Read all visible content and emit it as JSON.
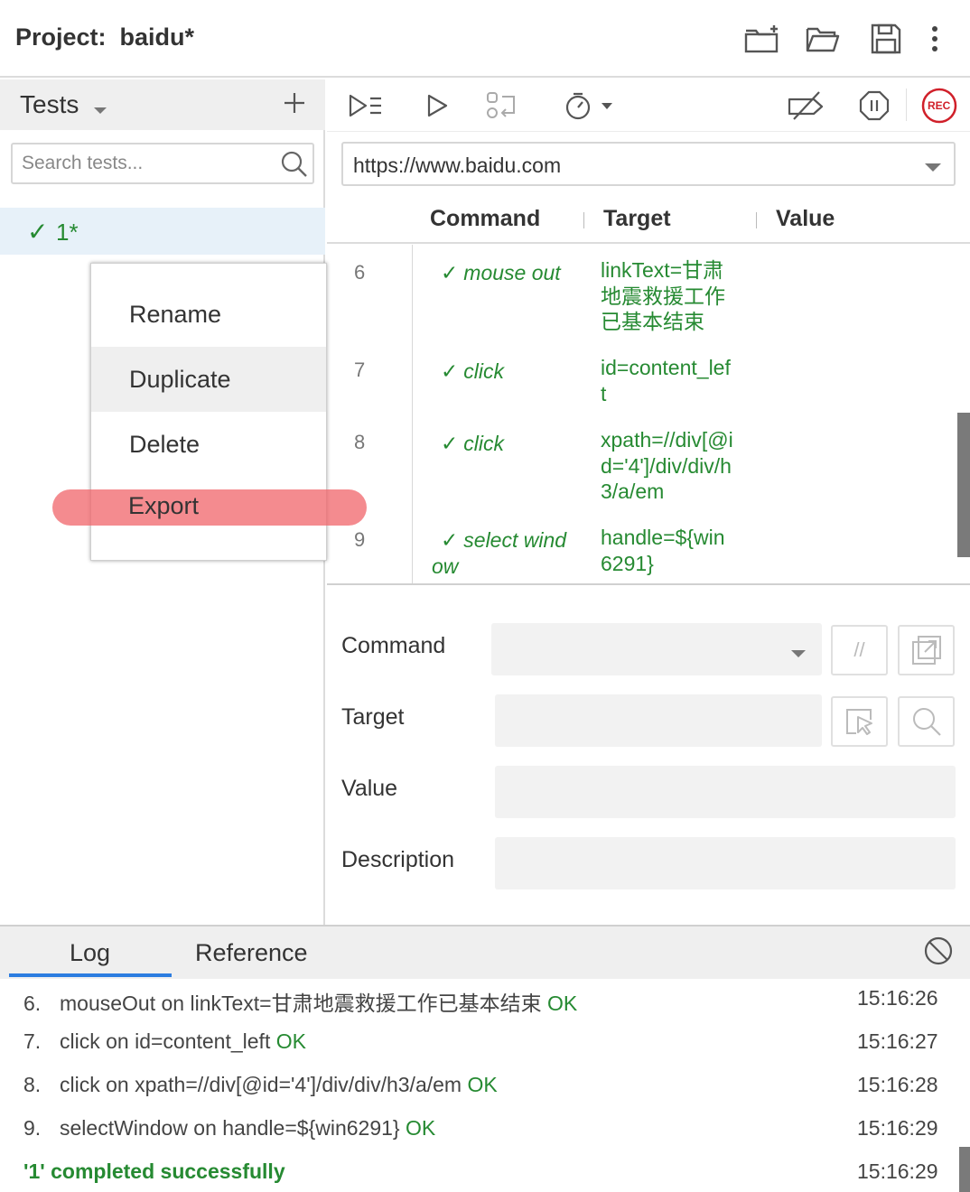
{
  "header": {
    "project_label": "Project:  baidu*",
    "icons": [
      "new-folder-icon",
      "open-folder-icon",
      "save-icon",
      "more-icon"
    ]
  },
  "tests_panel": {
    "title": "Tests",
    "search_placeholder": "Search tests...",
    "items": [
      {
        "status": "passed",
        "name": "1*"
      }
    ]
  },
  "context_menu": {
    "items": [
      "Rename",
      "Duplicate",
      "Delete",
      "Export"
    ],
    "hovered": "Duplicate",
    "highlighted": "Export"
  },
  "toolbar": {
    "buttons": [
      "run-all-icon",
      "run-icon",
      "step-icon",
      "speed-icon",
      "disable-breakpoints-icon",
      "pause-icon",
      "record-icon"
    ],
    "record_label": "REC"
  },
  "url": {
    "value": "https://www.baidu.com"
  },
  "table": {
    "headers": {
      "command": "Command",
      "target": "Target",
      "value": "Value"
    },
    "rows": [
      {
        "index": "6",
        "command": "mouse out",
        "target": "linkText=甘肃地震救援工作已基本结束",
        "value": ""
      },
      {
        "index": "7",
        "command": "click",
        "target": "id=content_left",
        "value": ""
      },
      {
        "index": "8",
        "command": "click",
        "target": "xpath=//div[@id='4']/div/div/h3/a/em",
        "value": ""
      },
      {
        "index": "9",
        "command": "select window",
        "target": "handle=${win6291}",
        "value": ""
      }
    ]
  },
  "editor": {
    "command_label": "Command",
    "target_label": "Target",
    "value_label": "Value",
    "description_label": "Description",
    "comment_btn": "//"
  },
  "log": {
    "tabs": [
      "Log",
      "Reference"
    ],
    "active_tab": "Log",
    "entries": [
      {
        "num": "6.",
        "text": "mouseOut on linkText=甘肃地震救援工作已基本结束",
        "status": "OK",
        "time": "15:16:26"
      },
      {
        "num": "7.",
        "text": "click on id=content_left",
        "status": "OK",
        "time": "15:16:27"
      },
      {
        "num": "8.",
        "text": "click on xpath=//div[@id='4']/div/div/h3/a/em",
        "status": "OK",
        "time": "15:16:28"
      },
      {
        "num": "9.",
        "text": "selectWindow on handle=${win6291}",
        "status": "OK",
        "time": "15:16:29"
      }
    ],
    "summary": {
      "text": "'1' completed successfully",
      "time": "15:16:29"
    }
  },
  "colors": {
    "pass_green": "#268a32",
    "accent_blue": "#2c7de0",
    "record_red": "#d0202a",
    "export_highlight": "#f06469"
  }
}
